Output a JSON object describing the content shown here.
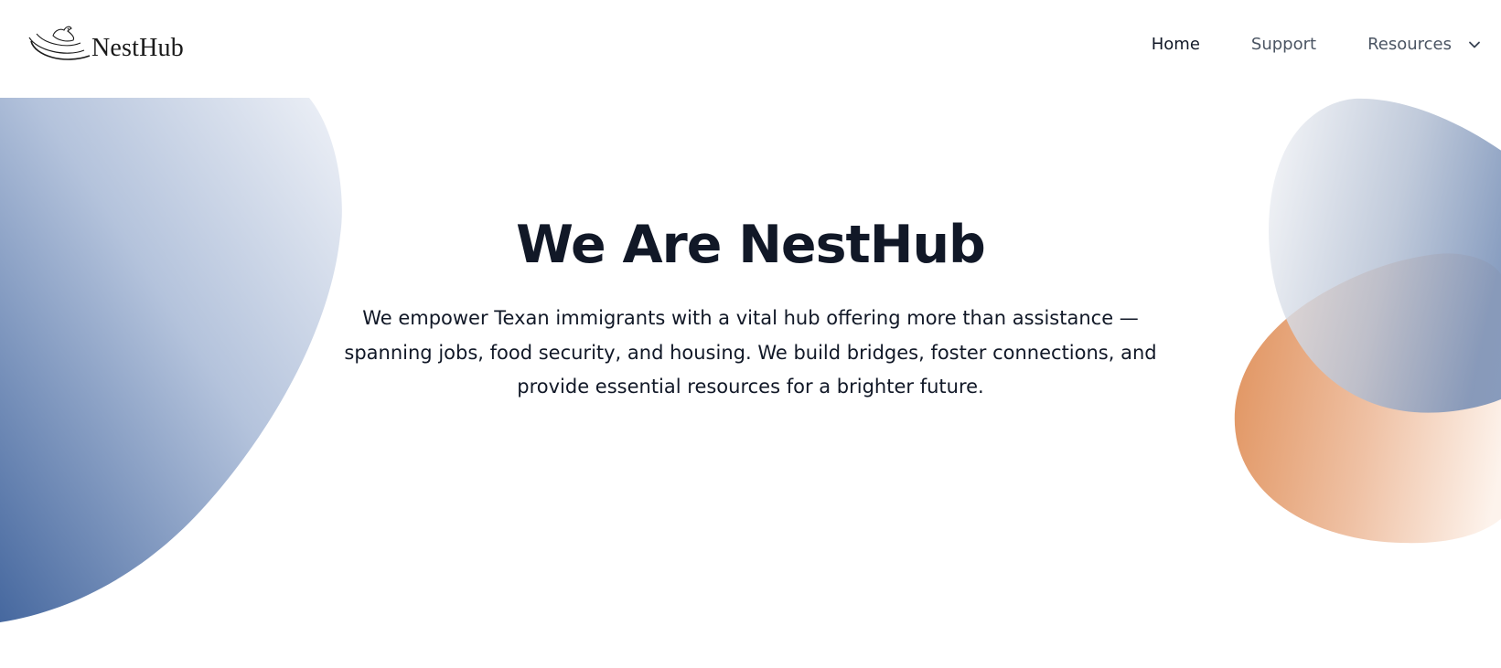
{
  "brand": {
    "name": "NestHub",
    "logo_icon": "nest-bird-logo-icon"
  },
  "nav": {
    "items": [
      {
        "label": "Home",
        "active": true
      },
      {
        "label": "Support",
        "active": false
      },
      {
        "label": "Resources",
        "active": false,
        "dropdown": true,
        "icon": "chevron-down-icon"
      }
    ]
  },
  "hero": {
    "title": "We Are NestHub",
    "description": "We empower Texan immigrants with a vital hub offering more than assistance — spanning jobs, food security, and housing. We build bridges, foster connections, and provide essential resources for a brighter future."
  },
  "colors": {
    "text_primary": "#111827",
    "nav_text": "#4b5563",
    "blue_gradient_start": "#e8ecf4",
    "blue_gradient_end": "#4a6ea8",
    "orange_gradient_start": "#e39a6c",
    "orange_gradient_end": "#fcf1ea"
  }
}
